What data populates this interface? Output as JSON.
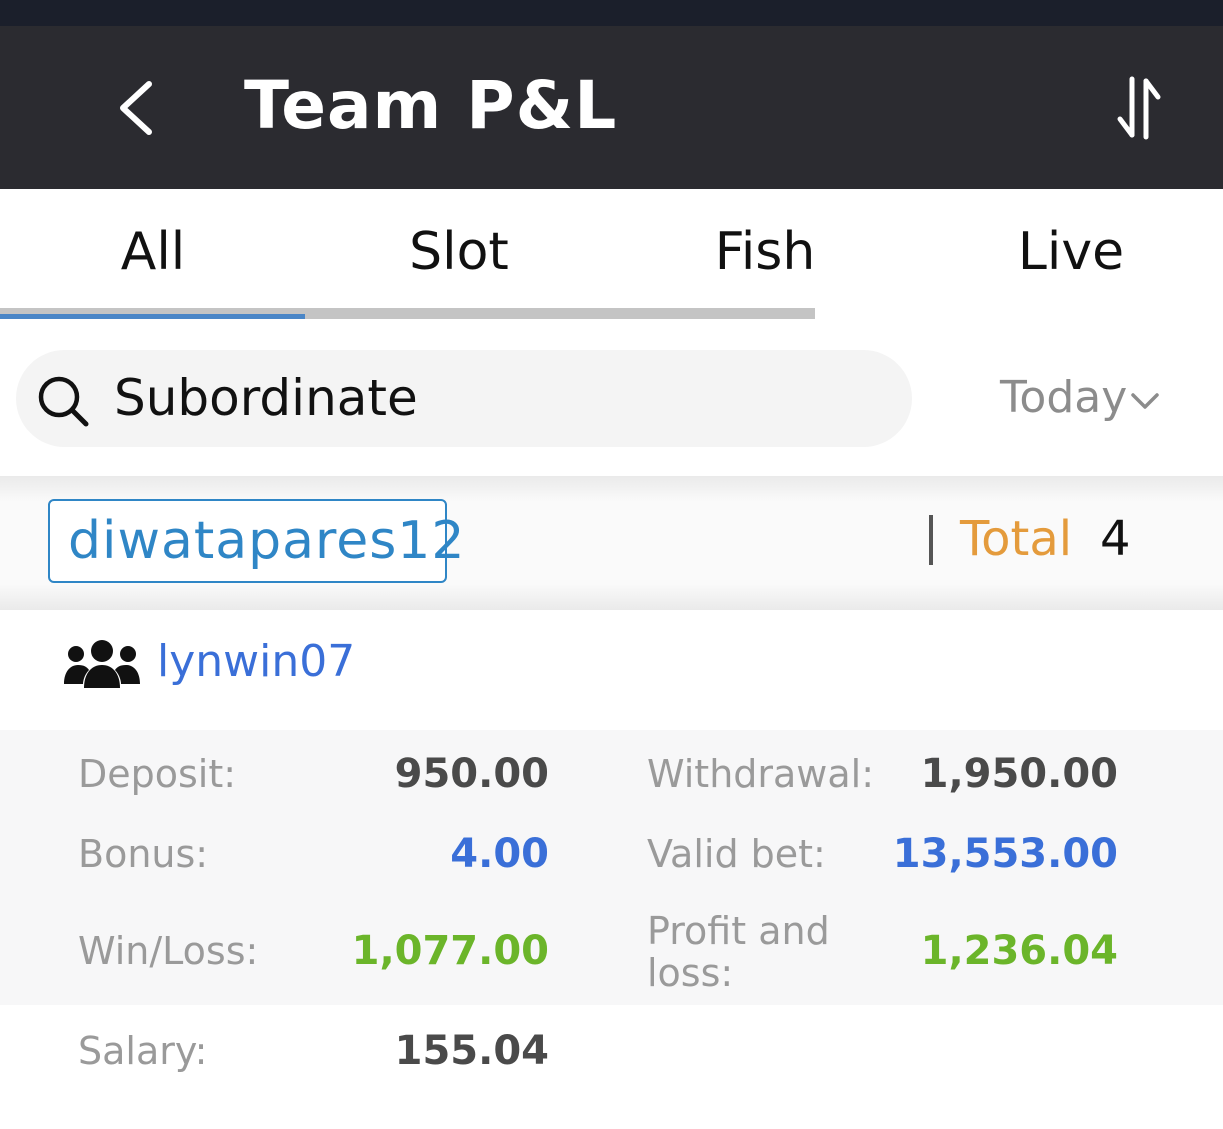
{
  "header": {
    "title": "Team P&L",
    "back_icon": "chevron-left-icon",
    "sort_icon": "sort-arrows-icon"
  },
  "tabs": [
    {
      "label": "All",
      "active": true
    },
    {
      "label": "Slot",
      "active": false
    },
    {
      "label": "Fish",
      "active": false
    },
    {
      "label": "Live",
      "active": false
    }
  ],
  "search": {
    "placeholder": "Subordinate",
    "icon": "search-icon"
  },
  "date_filter": {
    "value": "Today",
    "icon": "chevron-down-icon"
  },
  "team": {
    "username": "diwatapares12",
    "total_label": "Total",
    "total_count": "4"
  },
  "member": {
    "icon": "group-icon",
    "name": "lynwin07",
    "stats": {
      "deposit_label": "Deposit:",
      "deposit_value": "950.00",
      "withdrawal_label": "Withdrawal:",
      "withdrawal_value": "1,950.00",
      "bonus_label": "Bonus:",
      "bonus_value": "4.00",
      "valid_bet_label": "Valid bet:",
      "valid_bet_value": "13,553.00",
      "win_loss_label": "Win/Loss:",
      "win_loss_value": "1,077.00",
      "profit_loss_label": "Profit and loss:",
      "profit_loss_value": "1,236.04",
      "salary_label": "Salary:",
      "salary_value": "155.04"
    }
  },
  "colors": {
    "header_bg": "#2b2b30",
    "tab_indicator": "#4a86c7",
    "link_blue": "#3a6fd8",
    "positive_green": "#6bb52a",
    "total_orange": "#e49b3c",
    "chip_blue": "#2f86c6"
  }
}
